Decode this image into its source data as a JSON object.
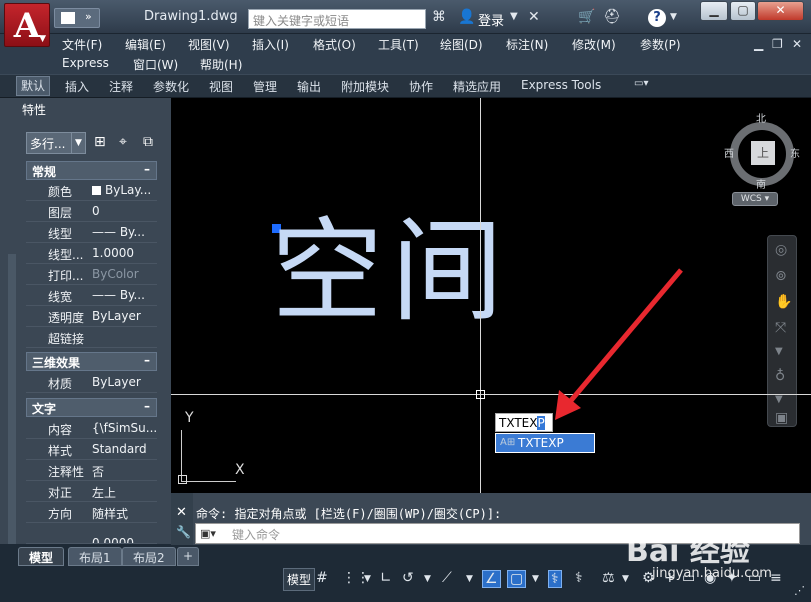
{
  "titlebar": {
    "app_logo": "A",
    "doc_title": "Drawing1.dwg",
    "search_placeholder": "键入关键字或短语",
    "login": "登录"
  },
  "menus": [
    "文件(F)",
    "编辑(E)",
    "视图(V)",
    "插入(I)",
    "格式(O)",
    "工具(T)",
    "绘图(D)",
    "标注(N)",
    "修改(M)",
    "参数(P)",
    "Express",
    "窗口(W)",
    "帮助(H)"
  ],
  "ribbon_tabs": [
    "默认",
    "插入",
    "注释",
    "参数化",
    "视图",
    "管理",
    "输出",
    "附加模块",
    "协作",
    "精选应用",
    "Express Tools"
  ],
  "palette": {
    "title": "特性",
    "object_type": "多行...",
    "sections": [
      {
        "title": "常规",
        "toggle": "–"
      },
      {
        "title": "三维效果",
        "toggle": "–"
      },
      {
        "title": "文字",
        "toggle": "–"
      }
    ],
    "general": [
      {
        "name": "颜色",
        "value": "ByLay..."
      },
      {
        "name": "图层",
        "value": "0"
      },
      {
        "name": "线型",
        "value": "—— By..."
      },
      {
        "name": "线型...",
        "value": "1.0000"
      },
      {
        "name": "打印...",
        "value": "ByColor"
      },
      {
        "name": "线宽",
        "value": "—— By..."
      },
      {
        "name": "透明度",
        "value": "ByLayer"
      },
      {
        "name": "超链接",
        "value": ""
      }
    ],
    "effects3d": [
      {
        "name": "材质",
        "value": "ByLayer"
      }
    ],
    "text": [
      {
        "name": "内容",
        "value": "{\\fSimSu..."
      },
      {
        "name": "样式",
        "value": "Standard"
      },
      {
        "name": "注释性",
        "value": "否"
      },
      {
        "name": "对正",
        "value": "左上"
      },
      {
        "name": "方向",
        "value": "随样式"
      },
      {
        "name": "...",
        "value": "0.0000"
      }
    ]
  },
  "layout_tabs": [
    "模型",
    "布局1",
    "布局2",
    "+"
  ],
  "canvas": {
    "mtext": "空间",
    "viewcube": {
      "north": "北",
      "south": "南",
      "east": "东",
      "west": "西",
      "face": "上"
    },
    "wcs": "WCS",
    "ucs_x": "X",
    "ucs_y": "Y",
    "dynamic_input_text": "TXTEX",
    "dynamic_input_selected": "P",
    "autocomplete_item": "TXTEXP"
  },
  "command": {
    "history": "命令: 指定对角点或 [栏选(F)/圈围(WP)/圈交(CP)]:",
    "placeholder": "键入命令"
  },
  "statusbar": {
    "model": "模型"
  },
  "watermark": {
    "main": "Bai 经验",
    "sub": "jingyan.baidu.com"
  },
  "colors": {
    "accent": "#3b7bd4",
    "arrow": "#e8282f",
    "text_object": "#c6d9f5",
    "grip": "#1e6cff"
  }
}
